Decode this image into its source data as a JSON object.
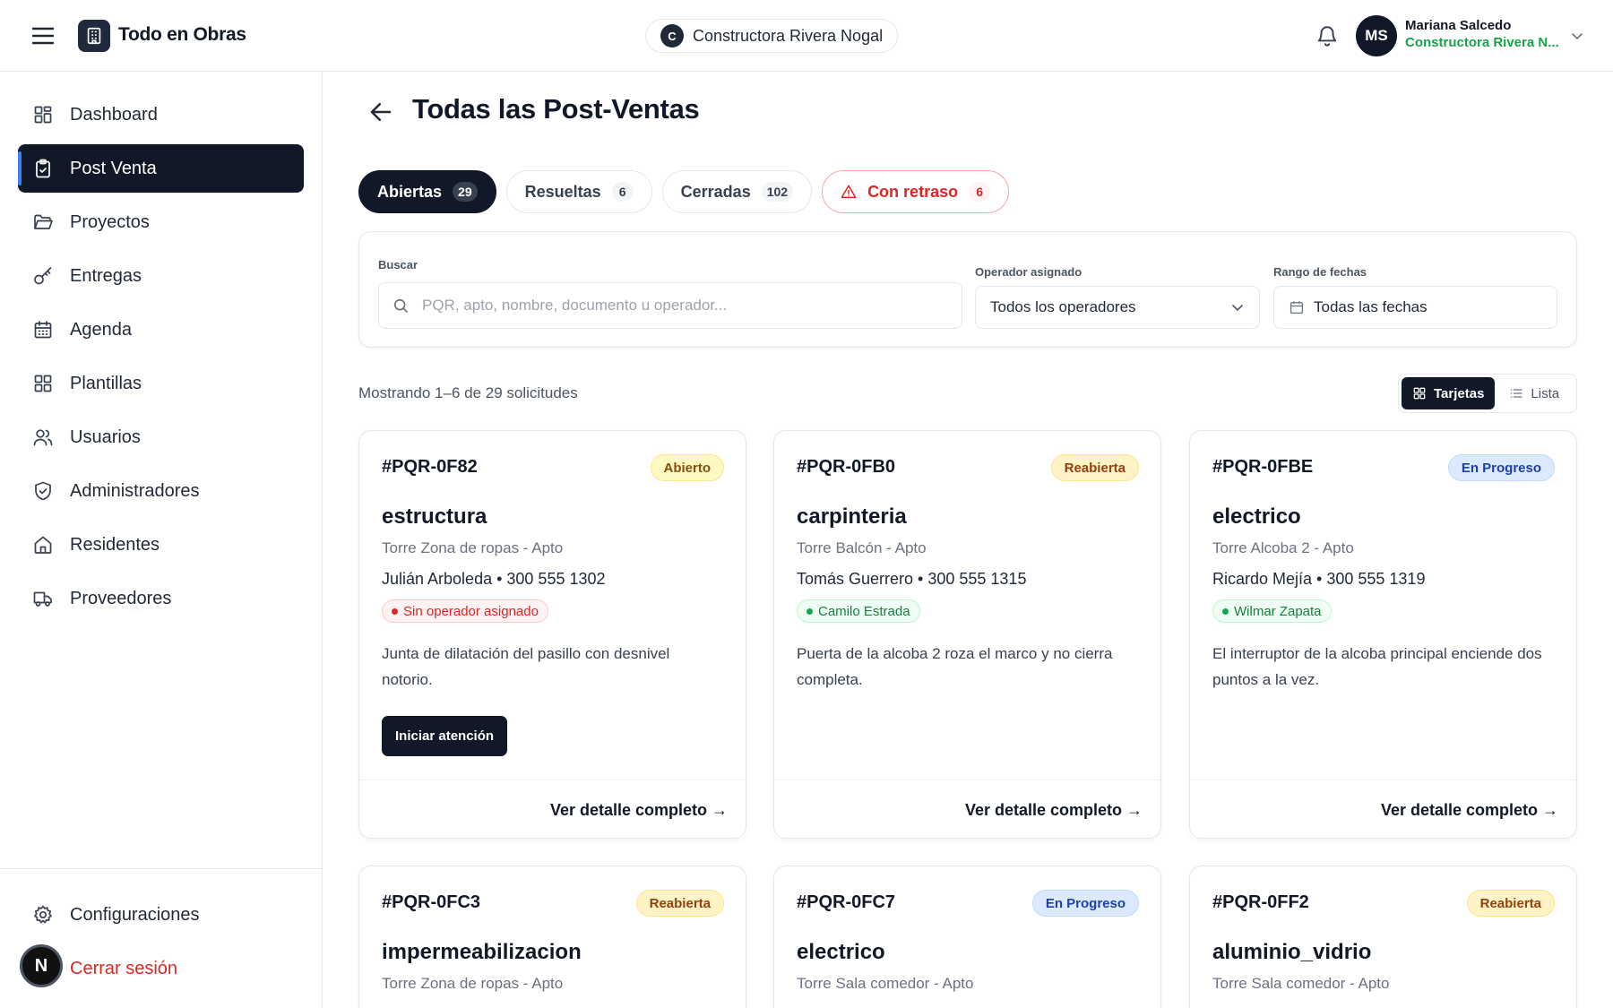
{
  "app": {
    "title": "Todo en Obras"
  },
  "company_pill": {
    "initial": "C",
    "name": "Constructora Rivera Nogal"
  },
  "user": {
    "initials": "MS",
    "name": "Mariana Salcedo",
    "company": "Constructora Rivera N..."
  },
  "sidebar": {
    "items": [
      {
        "label": "Dashboard",
        "icon": "grid-icon"
      },
      {
        "label": "Post Venta",
        "icon": "clipboard-check-icon",
        "active": true
      },
      {
        "label": "Proyectos",
        "icon": "folder-open-icon"
      },
      {
        "label": "Entregas",
        "icon": "key-icon"
      },
      {
        "label": "Agenda",
        "icon": "calendar-icon"
      },
      {
        "label": "Plantillas",
        "icon": "template-icon"
      },
      {
        "label": "Usuarios",
        "icon": "users-icon"
      },
      {
        "label": "Administradores",
        "icon": "shield-check-icon"
      },
      {
        "label": "Residentes",
        "icon": "home-icon"
      },
      {
        "label": "Proveedores",
        "icon": "truck-icon"
      }
    ],
    "settings_label": "Configuraciones",
    "logout_label": "Cerrar sesión",
    "badge_initial": "N"
  },
  "page": {
    "title": "Todas las Post-Ventas"
  },
  "tabs": [
    {
      "label": "Abiertas",
      "count": "29",
      "active": true
    },
    {
      "label": "Resueltas",
      "count": "6"
    },
    {
      "label": "Cerradas",
      "count": "102"
    },
    {
      "label": "Con retraso",
      "count": "6",
      "warning": true
    }
  ],
  "filters": {
    "search_label": "Buscar",
    "search_placeholder": "PQR, apto, nombre, documento u operador...",
    "operator_label": "Operador asignado",
    "operator_value": "Todos los operadores",
    "date_label": "Rango de fechas",
    "date_value": "Todas las fechas"
  },
  "results": {
    "showing": "Mostrando 1–6 de 29 solicitudes"
  },
  "view_toggle": {
    "cards": "Tarjetas",
    "list": "Lista",
    "selected": "Tarjetas"
  },
  "cards": [
    {
      "code": "#PQR-0F82",
      "status": "Abierto",
      "category": "estructura",
      "location": "Torre Zona de ropas - Apto",
      "contact": "Julián Arboleda • 300 555 1302",
      "operator": "Sin operador asignado",
      "description": "Junta de dilatación del pasillo con desnivel notorio.",
      "action": "Iniciar atención",
      "detail": "Ver detalle completo →"
    },
    {
      "code": "#PQR-0FB0",
      "status": "Reabierta",
      "category": "carpinteria",
      "location": "Torre Balcón - Apto",
      "contact": "Tomás Guerrero • 300 555 1315",
      "operator": "Camilo Estrada",
      "description": "Puerta de la alcoba 2 roza el marco y no cierra completa.",
      "detail": "Ver detalle completo →"
    },
    {
      "code": "#PQR-0FBE",
      "status": "En Progreso",
      "category": "electrico",
      "location": "Torre Alcoba 2 - Apto",
      "contact": "Ricardo Mejía • 300 555 1319",
      "operator": "Wilmar Zapata",
      "description": "El interruptor de la alcoba principal enciende dos puntos a la vez.",
      "detail": "Ver detalle completo →"
    },
    {
      "code": "#PQR-0FC3",
      "status": "Reabierta",
      "category": "impermeabilizacion",
      "location": "Torre Zona de ropas - Apto"
    },
    {
      "code": "#PQR-0FC7",
      "status": "En Progreso",
      "category": "electrico",
      "location": "Torre Sala comedor - Apto"
    },
    {
      "code": "#PQR-0FF2",
      "status": "Reabierta",
      "category": "aluminio_vidrio",
      "location": "Torre Sala comedor - Apto"
    }
  ],
  "colors": {
    "primary": "#111827",
    "accent": "#3b82f6",
    "success": "#16a34a",
    "danger": "#dc2626"
  }
}
